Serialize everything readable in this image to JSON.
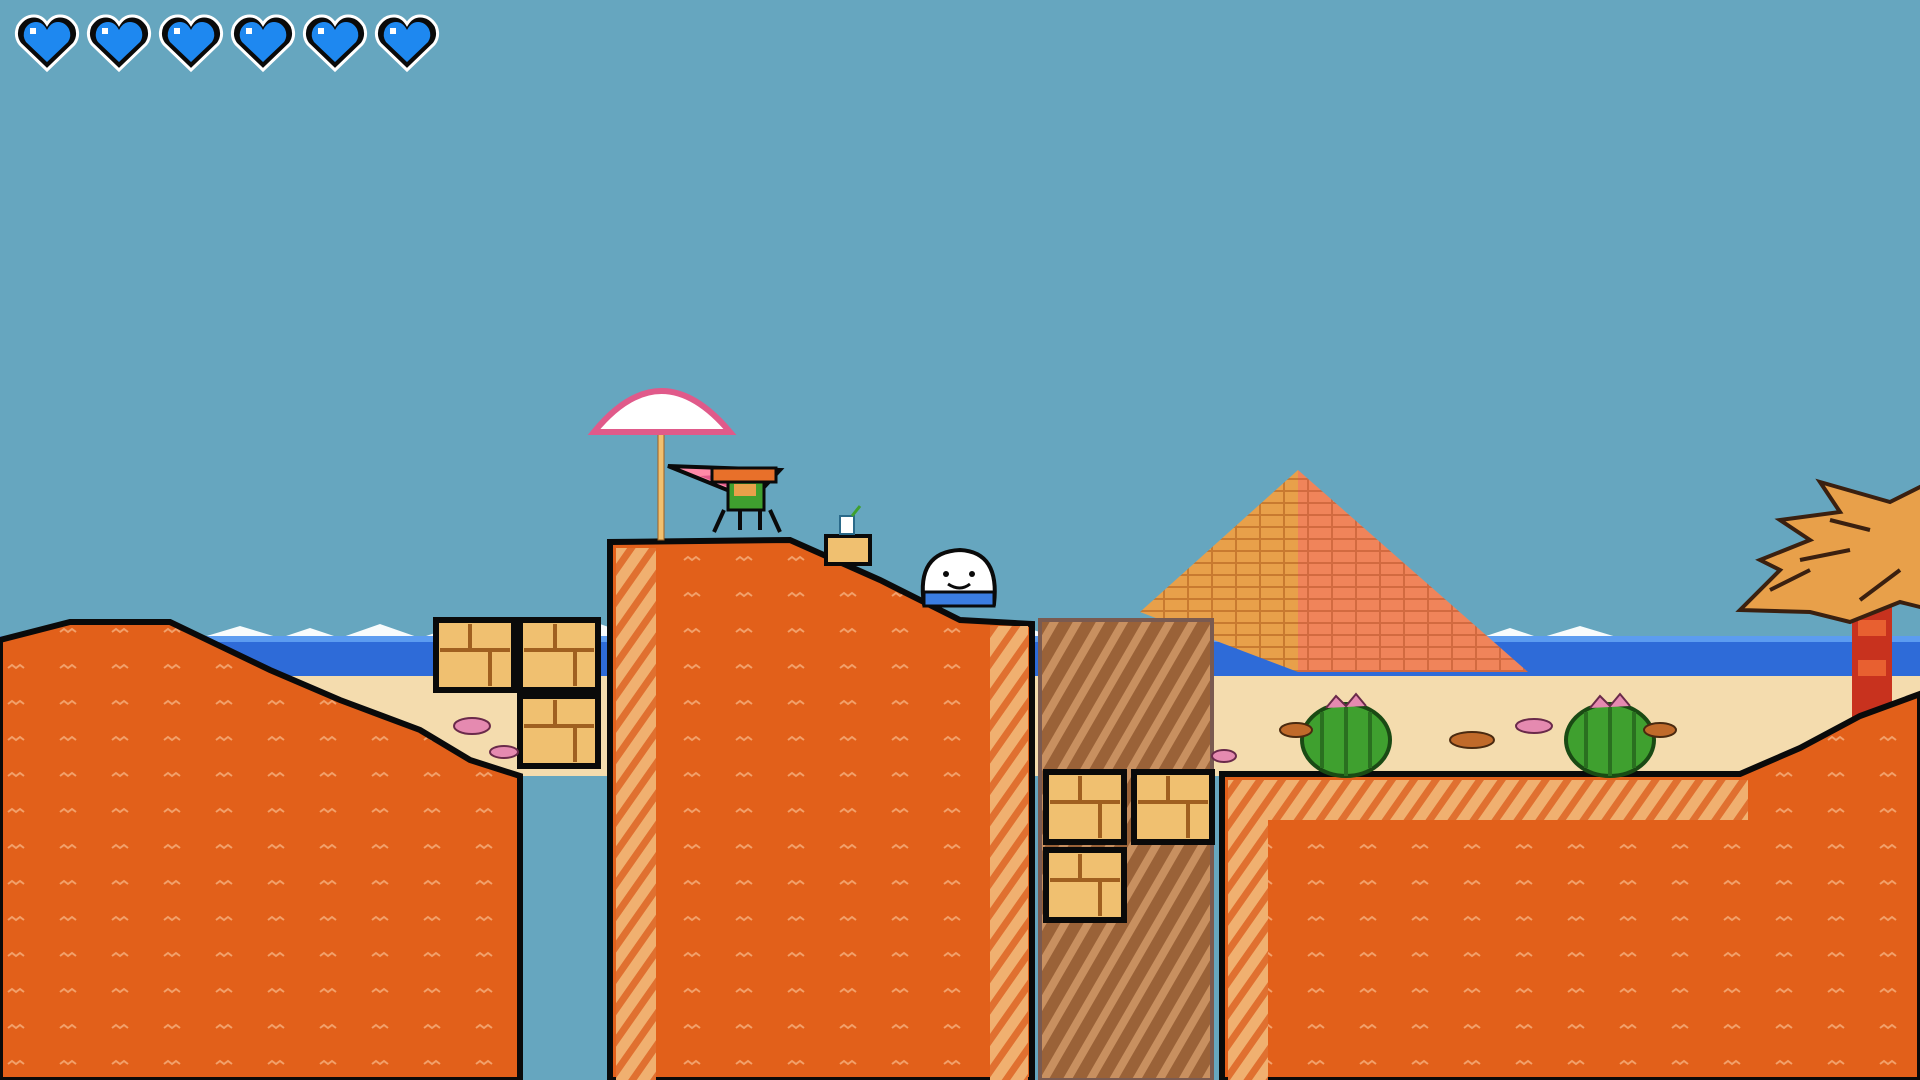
{
  "hud": {
    "hearts": [
      {
        "state": "full"
      },
      {
        "state": "full"
      },
      {
        "state": "full"
      },
      {
        "state": "full"
      },
      {
        "state": "full"
      },
      {
        "state": "full"
      }
    ]
  },
  "palette": {
    "sky": "#66a6bf",
    "sea": "#2e6bd8",
    "sand_light": "#f4dcae",
    "sand_orange": "#e2601a",
    "sand_stripe": "#f2b574",
    "outline": "#0a0a0a",
    "heart_blue": "#1e88f0",
    "brick_fill": "#f0c070",
    "cactus_green": "#3fa02f",
    "flower_pink": "#e58ab0",
    "pyramid_gold": "#e8a04a",
    "pyramid_orange": "#e8804a",
    "pit_brown": "#8a5a30"
  },
  "entities": {
    "player": {
      "name": "hang-glider-character"
    },
    "enemy": {
      "name": "white-blob-enemy"
    },
    "pickup": {
      "name": "drink-cup"
    }
  }
}
